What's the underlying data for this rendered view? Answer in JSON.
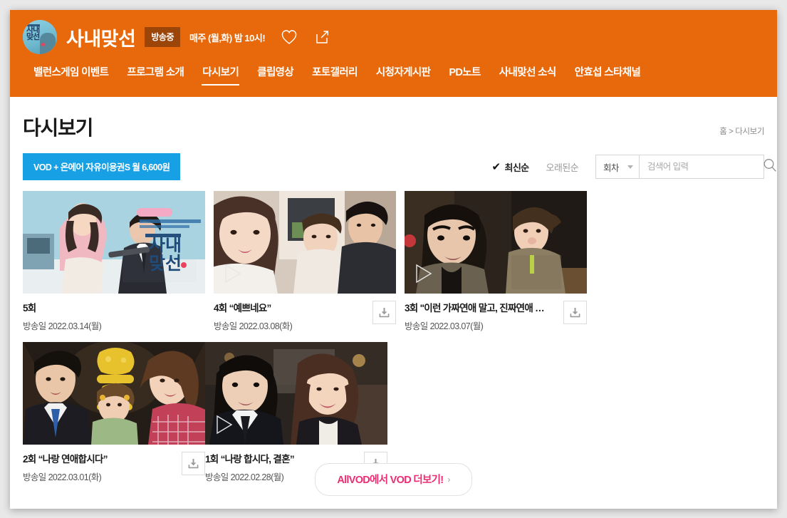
{
  "header": {
    "logo_icon": "program-logo-circle",
    "program_title": "사내맞선",
    "onair_badge": "방송중",
    "schedule": "매주 (월,화) 밤 10시!",
    "favorite_icon": "heart-icon",
    "share_icon": "share-icon",
    "brand_color": "#e8690b",
    "badge_color": "#9c4508"
  },
  "nav": {
    "items": [
      {
        "label": "밸런스게임 이벤트",
        "active": false
      },
      {
        "label": "프로그램 소개",
        "active": false
      },
      {
        "label": "다시보기",
        "active": true
      },
      {
        "label": "클립영상",
        "active": false
      },
      {
        "label": "포토갤러리",
        "active": false
      },
      {
        "label": "시청자게시판",
        "active": false
      },
      {
        "label": "PD노트",
        "active": false
      },
      {
        "label": "사내맞선 소식",
        "active": false
      },
      {
        "label": "안효섭 스타채널",
        "active": false
      }
    ]
  },
  "page": {
    "title": "다시보기",
    "breadcrumb": "홈 > 다시보기"
  },
  "toolbar": {
    "promo_label": "VOD + 온에어 자유이용권S 월 6,600원",
    "promo_color": "#18a0e5",
    "sort_newest": "최신순",
    "sort_oldest": "오래된순",
    "sort_selected": "최신순",
    "check_glyph": "✔",
    "select_label": "회차",
    "search_placeholder": "검색어 입력",
    "search_value": "",
    "search_icon": "search-icon"
  },
  "videos": [
    {
      "title": "5회",
      "date": "방송일 2022.03.14(월)",
      "has_play": false,
      "has_download": false,
      "thumb_kind": "poster"
    },
    {
      "title": "4회 “예쁘네요”",
      "date": "방송일 2022.03.08(화)",
      "has_play": true,
      "has_download": true,
      "thumb_kind": "scene-cafe"
    },
    {
      "title": "3회 \"이런 가짜연애 말고, 진짜연애 …",
      "date": "방송일 2022.03.07(월)",
      "has_play": true,
      "has_download": true,
      "thumb_kind": "scene-office"
    },
    {
      "title": "2회 “나랑 연애합시다”",
      "date": "방송일 2022.03.01(화)",
      "has_play": false,
      "has_download": true,
      "thumb_kind": "scene-party"
    },
    {
      "title": "1회 “나랑 합시다, 결혼”",
      "date": "방송일 2022.02.28(월)",
      "has_play": true,
      "has_download": true,
      "thumb_kind": "scene-restaurant"
    }
  ],
  "footer": {
    "more_accent": "AllVOD에서 VOD 더보기!",
    "more_chevron": "›",
    "accent_color": "#ec2b72"
  }
}
